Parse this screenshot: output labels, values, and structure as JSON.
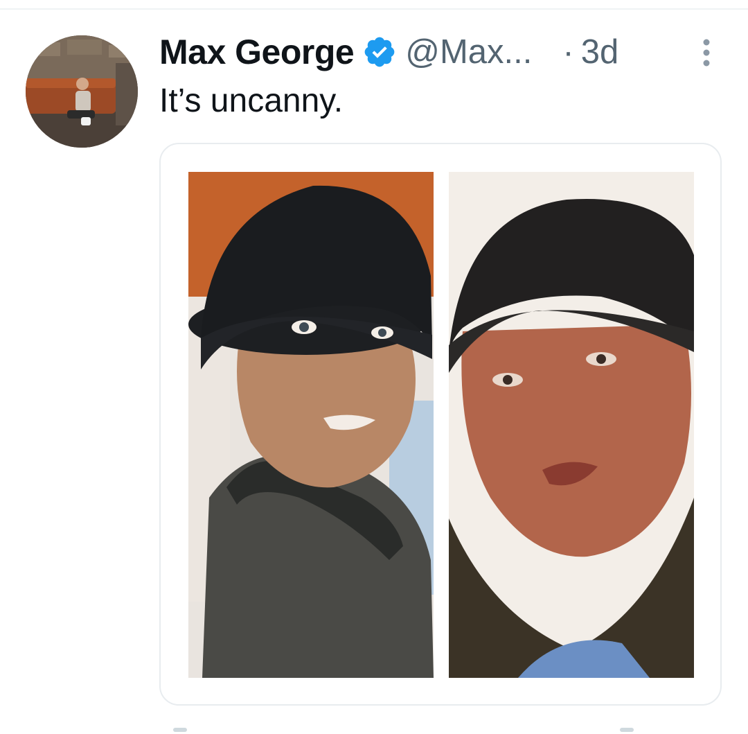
{
  "tweet": {
    "author": {
      "display_name": "Max George",
      "handle": "@Max...",
      "verified": true,
      "avatar_icon": "profile-photo-man-on-leather-sofa"
    },
    "timestamp_separator": "·",
    "timestamp": "3d",
    "text": "It’s uncanny.",
    "media": {
      "images": [
        {
          "subject": "photo-man-black-beanie-dark-jacket"
        },
        {
          "subject": "photo-man-black-beanie-fur-collar-coat"
        }
      ]
    }
  },
  "colors": {
    "text_primary": "#0f1419",
    "text_secondary": "#536471",
    "verified_badge": "#1d9bf0",
    "card_border": "#e8ecef"
  }
}
